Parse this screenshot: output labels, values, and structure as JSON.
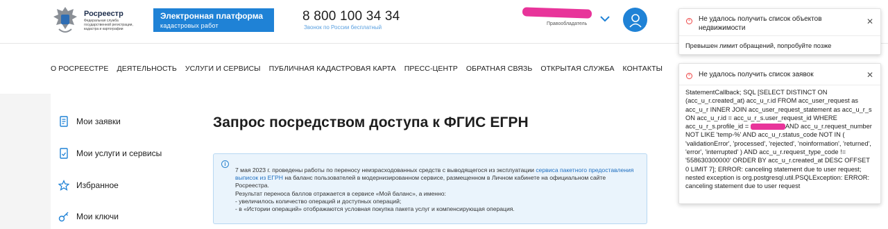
{
  "header": {
    "logo_name": "Росреестр",
    "logo_sub": "Федеральная служба государственной регистрации, кадастра и картографии",
    "platform_title": "Электронная платформа",
    "platform_sub": "кадастровых работ",
    "phone": "8 800 100 34 34",
    "phone_sub": "Звонок по России бесплатный",
    "user_role": "Правообладатель",
    "accent": "#1f82d6"
  },
  "nav": {
    "items": [
      {
        "label": "О РОСРЕЕСТРЕ"
      },
      {
        "label": "ДЕЯТЕЛЬНОСТЬ"
      },
      {
        "label": "УСЛУГИ И СЕРВИСЫ"
      },
      {
        "label": "ПУБЛИЧНАЯ КАДАСТРОВАЯ КАРТА"
      },
      {
        "label": "ПРЕСС-ЦЕНТР"
      },
      {
        "label": "ОБРАТНАЯ СВЯЗЬ"
      },
      {
        "label": "ОТКРЫТАЯ СЛУЖБА"
      },
      {
        "label": "КОНТАКТЫ"
      }
    ]
  },
  "sidebar": {
    "items": [
      {
        "label": "Мои заявки",
        "icon": "document-icon"
      },
      {
        "label": "Мои услуги и сервисы",
        "icon": "services-icon"
      },
      {
        "label": "Избранное",
        "icon": "star-icon"
      },
      {
        "label": "Мои ключи",
        "icon": "key-icon"
      }
    ]
  },
  "main": {
    "title": "Запрос посредством доступа к ФГИС ЕГРН",
    "info": {
      "part1": "7 мая 2023 г. проведены работы по переносу неизрасходованных средств с выводящегося из эксплуатации ",
      "link": "сервиса пакетного предоставления выписок из ЕГРН",
      "part2": " на баланс пользователей в модернизированном сервисе, размещенном в Личном кабинете на официальном сайте Росреестра.",
      "line2": "Результат переноса баллов отражается в сервисе «Мой баланс», а именно:",
      "line3": "- увеличилось количество операций и доступных операций;",
      "line4": "- в «Истории операций» отображаются условная покупка пакета услуг и компенсирующая операция."
    }
  },
  "toasts": [
    {
      "title": "Не удалось получить список объектов недвижимости",
      "body": "Превышен лимит обращений, попробуйте позже"
    },
    {
      "title": "Не удалось получить список заявок",
      "body_a": "StatementCallback; SQL [SELECT DISTINCT ON (acc_u_r.created_at) acc_u_r.id FROM acc_user_request as acc_u_r INNER JOIN acc_user_request_statement as acc_u_r_s ON acc_u_r.id = acc_u_r_s.user_request_id WHERE acc_u_r_s.profile_id = ",
      "body_b": "AND acc_u_r.request_number NOT LIKE 'temp-%' AND acc_u_r.status_code NOT IN ( 'validationError', 'processed', 'rejected', 'noinformation', 'returned', 'error', 'interrupted' ) AND acc_u_r.request_type_code != '558630300000' ORDER BY acc_u_r.created_at DESC OFFSET 0 LIMIT 7]; ERROR: canceling statement due to user request; nested exception is org.postgresql.util.PSQLException: ERROR: canceling statement due to user request"
    }
  ],
  "colors": {
    "error": "#e44444",
    "redaction": "#e8349a"
  }
}
